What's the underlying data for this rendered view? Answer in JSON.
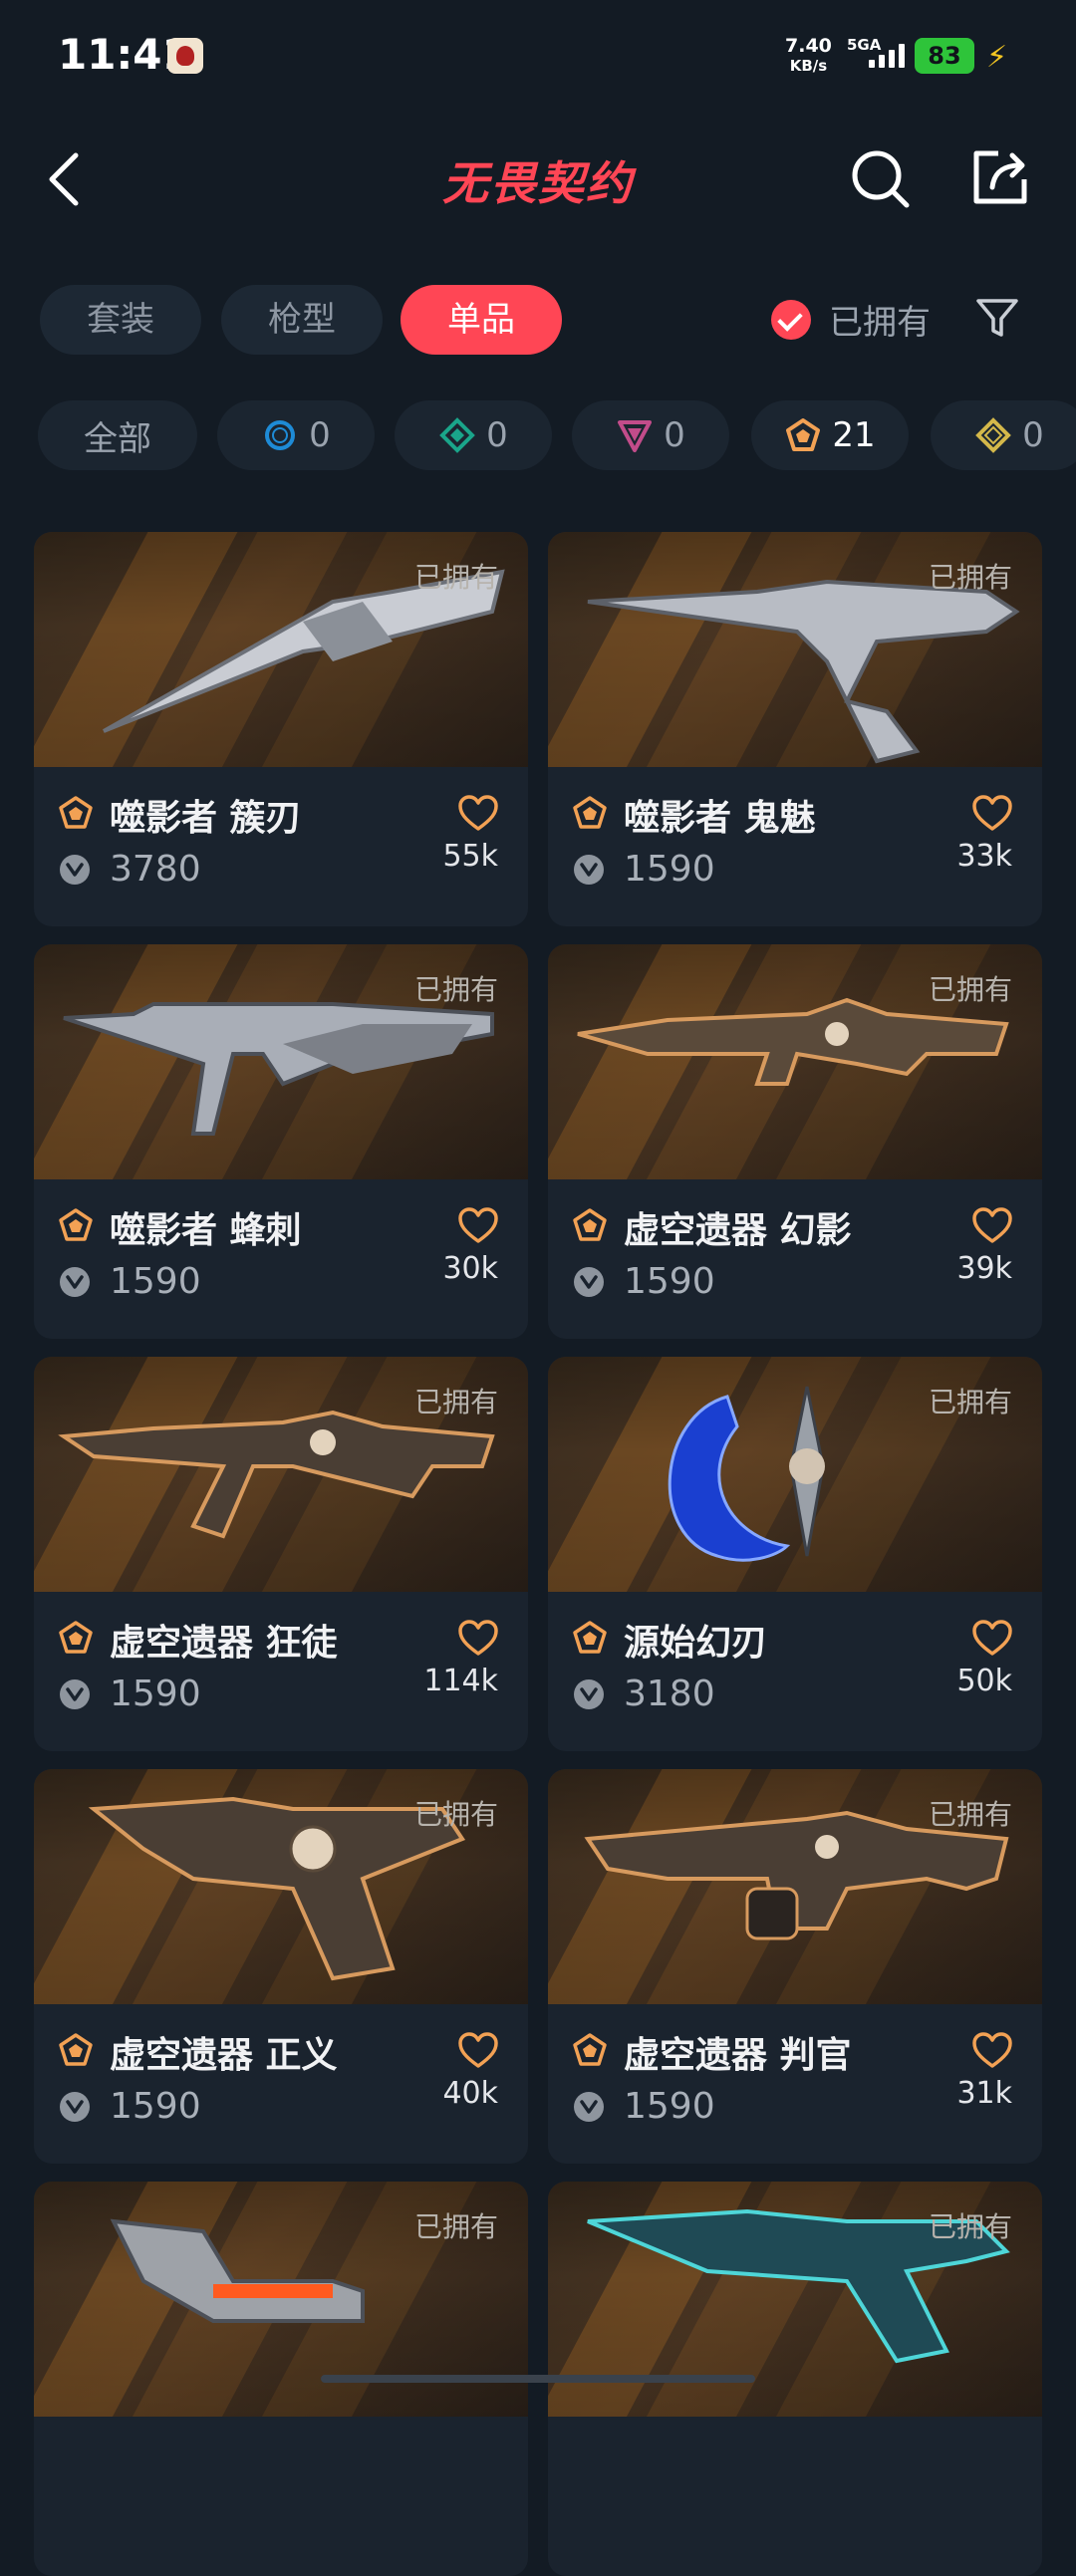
{
  "status_bar": {
    "time": "11:41",
    "net_speed_value": "7.40",
    "net_speed_unit": "KB/s",
    "network": "5GA",
    "battery": "83"
  },
  "header": {
    "title": "无畏契约"
  },
  "tabs": [
    {
      "label": "套装",
      "active": false
    },
    {
      "label": "枪型",
      "active": false
    },
    {
      "label": "单品",
      "active": true
    }
  ],
  "owned_filter": {
    "label": "已拥有",
    "checked": true
  },
  "rarity_chips": [
    {
      "label": "全部",
      "icon": "all"
    },
    {
      "icon": "select-tier-icon",
      "color": "#1e8bd6",
      "count": "0"
    },
    {
      "icon": "deluxe-tier-icon",
      "color": "#1aa58a",
      "count": "0"
    },
    {
      "icon": "premium-tier-icon",
      "color": "#c24c8a",
      "count": "0"
    },
    {
      "icon": "exclusive-tier-icon",
      "color": "#f2a154",
      "count": "21"
    },
    {
      "icon": "ultra-tier-icon",
      "color": "#d4b84a",
      "count": "0"
    }
  ],
  "items": [
    {
      "name": "噬影者 簇刃",
      "price": "3780",
      "likes": "55k",
      "owned": "已拥有"
    },
    {
      "name": "噬影者 鬼魅",
      "price": "1590",
      "likes": "33k",
      "owned": "已拥有"
    },
    {
      "name": "噬影者 蜂刺",
      "price": "1590",
      "likes": "30k",
      "owned": "已拥有"
    },
    {
      "name": "虚空遗器 幻影",
      "price": "1590",
      "likes": "39k",
      "owned": "已拥有"
    },
    {
      "name": "虚空遗器 狂徒",
      "price": "1590",
      "likes": "114k",
      "owned": "已拥有"
    },
    {
      "name": "源始幻刃",
      "price": "3180",
      "likes": "50k",
      "owned": "已拥有"
    },
    {
      "name": "虚空遗器 正义",
      "price": "1590",
      "likes": "40k",
      "owned": "已拥有"
    },
    {
      "name": "虚空遗器 判官",
      "price": "1590",
      "likes": "31k",
      "owned": "已拥有"
    },
    {
      "owned": "已拥有"
    },
    {
      "owned": "已拥有"
    }
  ],
  "colors": {
    "accent": "#ff4655",
    "exclusive_tier": "#f2a154",
    "background": "#131b24"
  }
}
